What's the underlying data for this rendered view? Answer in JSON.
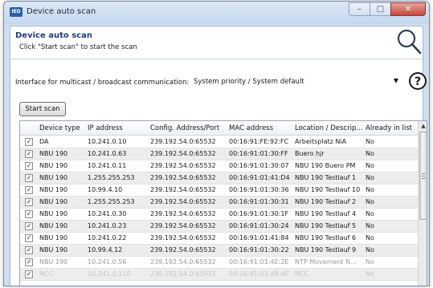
{
  "window": {
    "title": "Device auto scan",
    "icon_label": "IED",
    "buttons": {
      "minimize": "–",
      "maximize": "□",
      "close": "✕"
    }
  },
  "header": {
    "title": "Device auto scan",
    "subtitle": "Click \"Start scan\" to start the scan",
    "icon": "search-icon"
  },
  "interface": {
    "label": "Interface for multicast / broadcast communication:",
    "selected": "System priority / System default",
    "help_icon": "help-icon"
  },
  "start_button": {
    "label": "Start scan"
  },
  "table": {
    "columns": [
      "Device type",
      "IP address",
      "Config. Address/Port",
      "MAC address",
      "Location / Descrip...",
      "Already in list"
    ],
    "rows": [
      {
        "checked": true,
        "device_type": "DA",
        "ip": "10.241.0.10",
        "config": "239.192.54.0:65532",
        "mac": "00:16:91:FE:92:FC",
        "location": "Arbeitsplatz NiA",
        "in_list": "No"
      },
      {
        "checked": true,
        "device_type": "NBU 190",
        "ip": "10.241.0.63",
        "config": "239.192.54.0:65532",
        "mac": "00:16:91:01:30:FF",
        "location": "Buero hjr",
        "in_list": "No"
      },
      {
        "checked": true,
        "device_type": "NBU 190",
        "ip": "10.241.0.11",
        "config": "239.192.54.0:65532",
        "mac": "00:16:91:01:30:07",
        "location": "NBU 190  Buero PM",
        "in_list": "No"
      },
      {
        "checked": true,
        "device_type": "NBU 190",
        "ip": "1.255.255.253",
        "config": "239.192.54.0:65532",
        "mac": "00:16:91:01:41:D4",
        "location": "NBU 190 Testlauf 1",
        "in_list": "No"
      },
      {
        "checked": true,
        "device_type": "NBU 190",
        "ip": "10.99.4.10",
        "config": "239.192.54.0:65532",
        "mac": "00:16:91:01:30:36",
        "location": "NBU 190 Testlauf 10",
        "in_list": "No"
      },
      {
        "checked": true,
        "device_type": "NBU 190",
        "ip": "1.255.255.253",
        "config": "239.192.54.0:65532",
        "mac": "00:16:91:01:30:31",
        "location": "NBU 190 Testlauf 2",
        "in_list": "No"
      },
      {
        "checked": true,
        "device_type": "NBU 190",
        "ip": "10.241.0.30",
        "config": "239.192.54.0:65532",
        "mac": "00:16:91:01:30:1F",
        "location": "NBU 190 Testlauf 4",
        "in_list": "No"
      },
      {
        "checked": true,
        "device_type": "NBU 190",
        "ip": "10.241.0.23",
        "config": "239.192.54.0:65532",
        "mac": "00:16:91:01:30:24",
        "location": "NBU 190 Testlauf 5",
        "in_list": "No"
      },
      {
        "checked": true,
        "device_type": "NBU 190",
        "ip": "10.241.0.22",
        "config": "239.192.54.0:65532",
        "mac": "00:16:91:01:41:84",
        "location": "NBU 190 Testlauf 6",
        "in_list": "No"
      },
      {
        "checked": true,
        "device_type": "NBU 190",
        "ip": "10.99.4.12",
        "config": "239.192.54.0:65532",
        "mac": "00:16:91:01:30:22",
        "location": "NBU 190 Testlauf 9",
        "in_list": "No"
      },
      {
        "checked": true,
        "device_type": "NBU 190",
        "ip": "10.241.0.56",
        "config": "239.192.54.0:65532",
        "mac": "00:16:91:01:4E:2E",
        "location": "NTP Movement N...",
        "in_list": "No"
      },
      {
        "checked": true,
        "device_type": "NCC",
        "ip": "10.241.0.110",
        "config": "239.192.54.0:65532",
        "mac": "00:16:91:01:4B:AF",
        "location": "NCC",
        "in_list": "No"
      }
    ]
  },
  "colors": {
    "title_blue": "#1f3f77",
    "window_frame": "#cfdff0",
    "close_red": "#c6463a",
    "row_shade": "#ededed"
  }
}
